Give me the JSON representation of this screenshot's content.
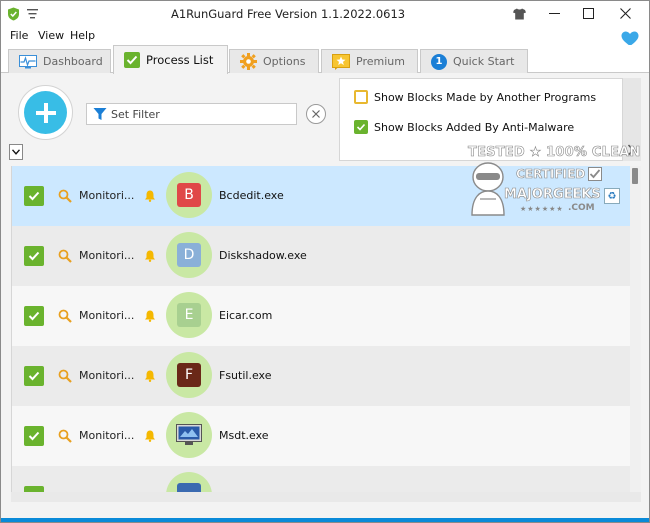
{
  "app": {
    "title": "A1RunGuard  Free Version 1.1.2022.0613"
  },
  "menu": [
    "File",
    "View",
    "Help"
  ],
  "tabs": [
    {
      "label": "Dashboard",
      "icon": "dashboard-icon",
      "active": false
    },
    {
      "label": "Process List",
      "icon": "checkbox-icon",
      "active": true
    },
    {
      "label": "Options",
      "icon": "gear-icon",
      "active": false
    },
    {
      "label": "Premium",
      "icon": "star-icon",
      "active": false
    },
    {
      "label": "Quick Start",
      "icon": "info-number-icon",
      "badge": "1",
      "active": false
    }
  ],
  "filter": {
    "placeholder": "Set Filter"
  },
  "options": {
    "show_other_blocks": {
      "label": "Show Blocks Made by Another Programs",
      "checked": false
    },
    "show_antimalware_blocks": {
      "label": "Show Blocks Added By Anti-Malware",
      "checked": true
    }
  },
  "watermark": {
    "line1": "TESTED ★ 100% CLEAN",
    "line2": "CERTIFIED",
    "line3": "MAJORGEEKS",
    "line4": ".COM"
  },
  "processes": [
    {
      "enabled": true,
      "mode": "Monitori...",
      "letter": "B",
      "letter_color": "#e04848",
      "name": "Bcdedit.exe",
      "selected": true
    },
    {
      "enabled": true,
      "mode": "Monitori...",
      "letter": "D",
      "letter_color": "#8ab0d8",
      "name": "Diskshadow.exe",
      "selected": false
    },
    {
      "enabled": true,
      "mode": "Monitori...",
      "letter": "E",
      "letter_color": "#a8d090",
      "name": "Eicar.com",
      "selected": false
    },
    {
      "enabled": true,
      "mode": "Monitori...",
      "letter": "F",
      "letter_color": "#6a2818",
      "name": "Fsutil.exe",
      "selected": false
    },
    {
      "enabled": true,
      "mode": "Monitori...",
      "letter": "",
      "letter_color": "#3a6ab0",
      "name": "Msdt.exe",
      "selected": false
    }
  ],
  "colors": {
    "accent_blue": "#38bde6",
    "check_green": "#6ab32e",
    "selected_row": "#cce8ff",
    "badge_green": "#c9e8a4",
    "heart": "#3aa8e8"
  }
}
